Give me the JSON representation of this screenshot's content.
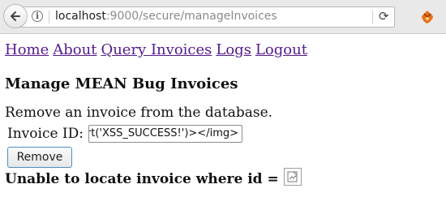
{
  "browser": {
    "back_icon": "back-arrow-icon",
    "info_icon": "i",
    "url_host": "localhost",
    "url_rest": ":9000/secure/manageInvoices",
    "reload_icon": "reload-icon",
    "extension_icon": "extension-icon"
  },
  "nav": {
    "items": [
      {
        "label": "Home"
      },
      {
        "label": "About"
      },
      {
        "label": "Query Invoices"
      },
      {
        "label": "Logs"
      },
      {
        "label": "Logout"
      }
    ]
  },
  "page": {
    "title": "Manage MEAN Bug Invoices",
    "description": "Remove an invoice from the database.",
    "invoice_label": "Invoice ID:",
    "invoice_value": "rt('XSS_SUCCESS!')></img>",
    "remove_label": "Remove",
    "error_text": "Unable to locate invoice where id ="
  },
  "colors": {
    "link_visited": "#551a8b",
    "button_border": "#4a90c2"
  }
}
